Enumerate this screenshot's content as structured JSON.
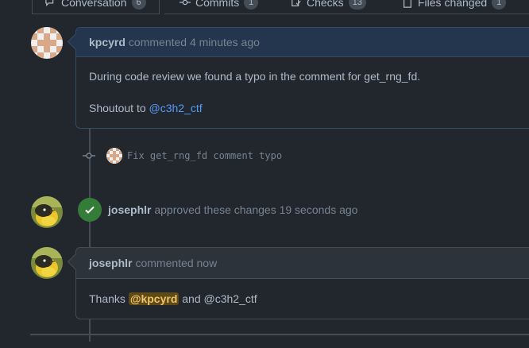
{
  "tabs": [
    {
      "label": "Conversation",
      "count": "6",
      "icon": "comment-discussion-icon"
    },
    {
      "label": "Commits",
      "count": "1",
      "icon": "commit-icon"
    },
    {
      "label": "Checks",
      "count": "13",
      "icon": "checklist-icon"
    },
    {
      "label": "Files changed",
      "count": "1",
      "icon": "file-diff-icon"
    }
  ],
  "comment1": {
    "author": "kpcyrd",
    "meta": "commented 4 minutes ago",
    "line1": "During code review we found a typo in the comment for get_rng_fd.",
    "line2_prefix": "Shoutout to ",
    "mention": "@c3h2_ctf"
  },
  "commit": {
    "message": "Fix get_rng_fd comment typo"
  },
  "review": {
    "author": "josephlr",
    "text": "approved these changes 19 seconds ago"
  },
  "comment2": {
    "author": "josephlr",
    "meta": "commented now",
    "prefix": "Thanks ",
    "mention_me": "@kpcyrd",
    "middle": " and ",
    "mention": "@c3h2_ctf"
  },
  "colors": {
    "background": "#22272e",
    "accent": "#539bf5",
    "approved": "#347d39",
    "mention_highlight": "#5e4a16"
  }
}
